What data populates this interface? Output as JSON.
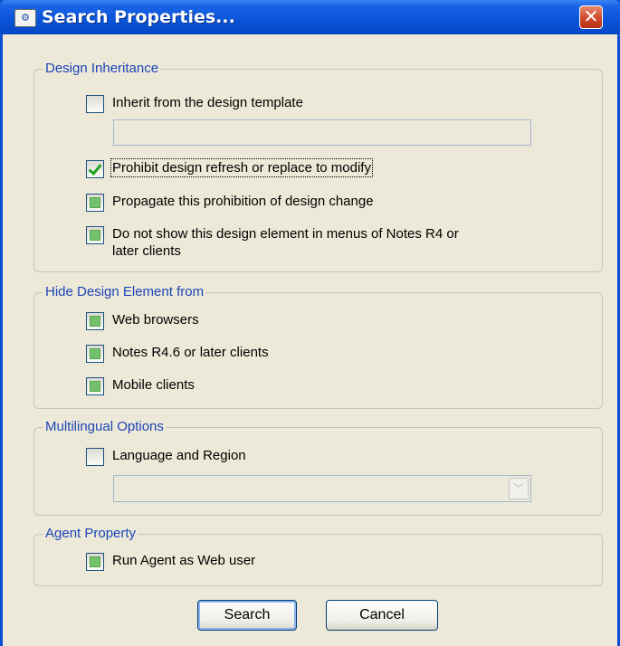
{
  "window": {
    "title": "Search Properties...",
    "icon": "notes-app-icon",
    "close_label": "✕"
  },
  "design_inheritance": {
    "legend": "Design Inheritance",
    "inherit": {
      "label": "Inherit from the design template",
      "checked": false
    },
    "template_value": "",
    "prohibit_refresh": {
      "label": "Prohibit design refresh or replace to modify",
      "checked": true
    },
    "propagate": {
      "label": "Propagate this prohibition of design change",
      "state": "indeterminate"
    },
    "dont_show": {
      "label_line1": "Do not show this design element in menus of Notes R4 or",
      "label_line2": "later clients",
      "state": "indeterminate"
    }
  },
  "hide_from": {
    "legend": "Hide Design Element from",
    "web": {
      "label": "Web browsers",
      "state": "indeterminate"
    },
    "notes": {
      "label": "Notes R4.6 or later clients",
      "state": "indeterminate"
    },
    "mobile": {
      "label": "Mobile clients",
      "state": "indeterminate"
    }
  },
  "multilingual": {
    "legend": "Multilingual Options",
    "language": {
      "label": "Language and Region",
      "checked": false
    },
    "language_value": "",
    "dropdown_arrow": "﹀"
  },
  "agent": {
    "legend": "Agent Property",
    "run_as_web_user": {
      "label": "Run Agent as Web user",
      "state": "indeterminate"
    }
  },
  "buttons": {
    "search": "Search",
    "cancel": "Cancel"
  }
}
